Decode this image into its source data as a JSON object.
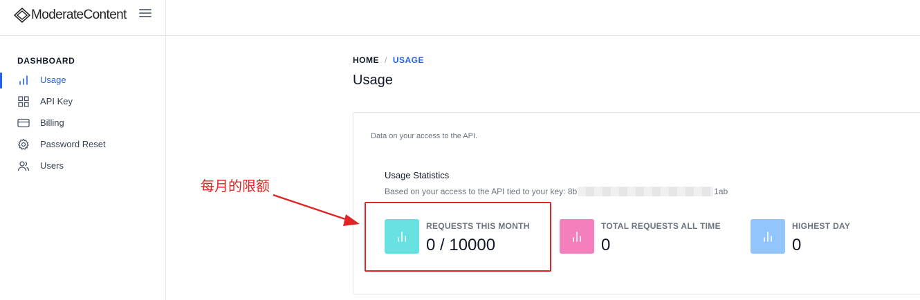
{
  "brand": {
    "name": "ModerateContent"
  },
  "sidebar": {
    "heading": "DASHBOARD",
    "items": [
      {
        "label": "Usage",
        "icon": "bar-chart-icon",
        "active": true
      },
      {
        "label": "API Key",
        "icon": "grid-icon",
        "active": false
      },
      {
        "label": "Billing",
        "icon": "credit-card-icon",
        "active": false
      },
      {
        "label": "Password Reset",
        "icon": "gear-icon",
        "active": false
      },
      {
        "label": "Users",
        "icon": "users-icon",
        "active": false
      }
    ]
  },
  "breadcrumb": {
    "home": "HOME",
    "separator": "/",
    "current": "USAGE"
  },
  "page": {
    "title": "Usage"
  },
  "card": {
    "description": "Data on your access to the API.",
    "stats_title": "Usage Statistics",
    "stats_subtitle_prefix": "Based on your access to the API tied to your key: 8b",
    "stats_subtitle_suffix": "1ab",
    "stats": [
      {
        "label": "REQUESTS THIS MONTH",
        "value": "0 / 10000",
        "color": "#67e1e1"
      },
      {
        "label": "TOTAL REQUESTS ALL TIME",
        "value": "0",
        "color": "#f47fbd"
      },
      {
        "label": "HIGHEST DAY",
        "value": "0",
        "color": "#93c5fd"
      }
    ]
  },
  "annotation": {
    "text": "每月的限额",
    "color": "#e02424"
  },
  "colors": {
    "accent": "#2563eb",
    "border": "#e5e7eb"
  }
}
